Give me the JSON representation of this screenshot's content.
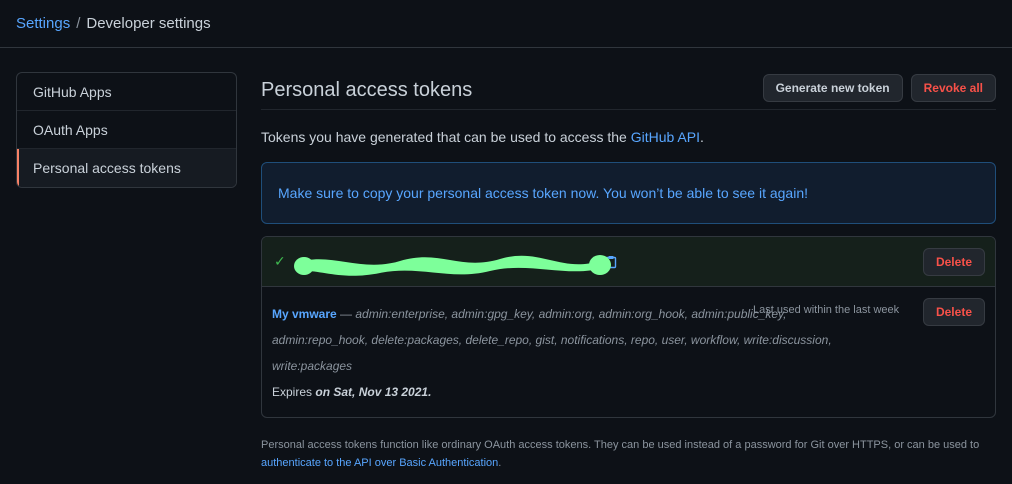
{
  "breadcrumb": {
    "root": "Settings",
    "separator": "/",
    "current": "Developer settings"
  },
  "sidebar": {
    "items": [
      {
        "label": "GitHub Apps"
      },
      {
        "label": "OAuth Apps"
      },
      {
        "label": "Personal access tokens"
      }
    ]
  },
  "header": {
    "title": "Personal access tokens",
    "generate_label": "Generate new token",
    "revoke_label": "Revoke all"
  },
  "intro": {
    "text": "Tokens you have generated that can be used to access the ",
    "link": "GitHub API",
    "suffix": "."
  },
  "flash": {
    "message": "Make sure to copy your personal access token now. You won’t be able to see it again!"
  },
  "token": {
    "new_delete_label": "Delete",
    "name": "My vmware",
    "dash": " — ",
    "scopes": "admin:enterprise, admin:gpg_key, admin:org, admin:org_hook, admin:public_key, admin:repo_hook, delete:packages, delete_repo, gist, notifications, repo, user, workflow, write:discussion, write:packages",
    "last_used": "Last used within the last week",
    "delete_label": "Delete",
    "expires_prefix": "Expires ",
    "expires_date": "on Sat, Nov 13 2021",
    "expires_suffix": "."
  },
  "footer": {
    "text": "Personal access tokens function like ordinary OAuth access tokens. They can be used instead of a password for Git over HTTPS, or can be used to ",
    "link": "authenticate to the API over Basic Authentication",
    "suffix": "."
  },
  "colors": {
    "background": "#0d1117",
    "link": "#58a6ff",
    "danger": "#f85149",
    "redaction": "#7dff9a",
    "selected_accent": "#f78166"
  }
}
